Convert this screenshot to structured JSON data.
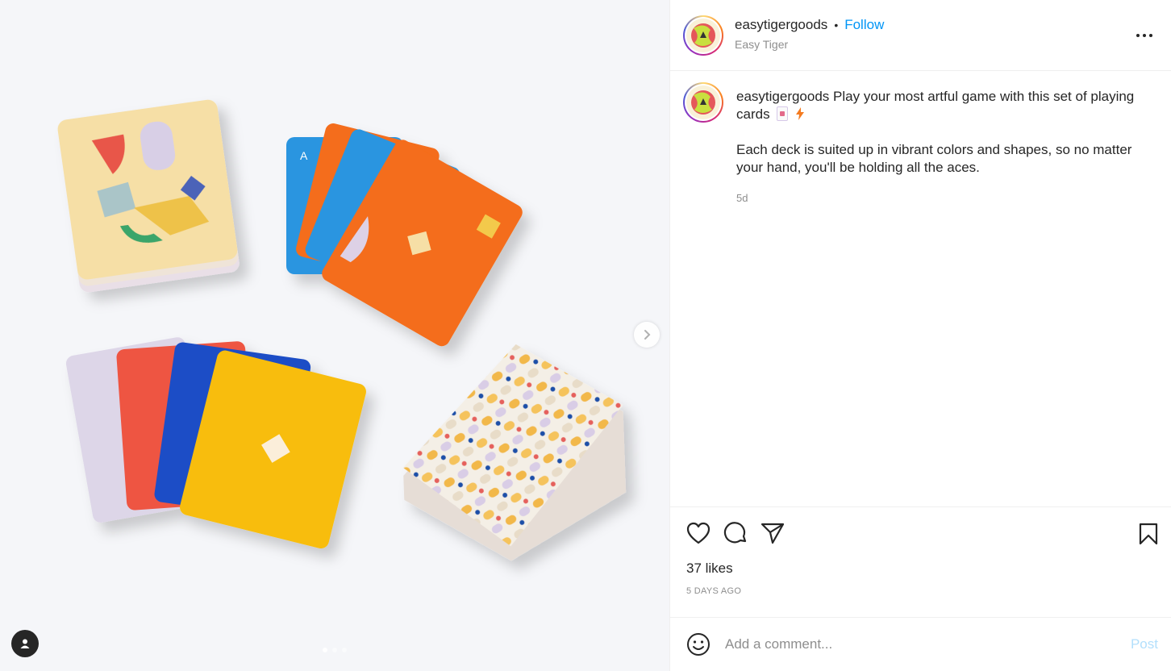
{
  "post": {
    "username": "easytigergoods",
    "separator": "•",
    "follow_label": "Follow",
    "subtitle": "Easy Tiger",
    "caption_line1": "Play your most artful game with this set of playing cards",
    "caption_para": "Each deck is suited up in vibrant colors and shapes, so no matter your hand, you'll be holding all the aces.",
    "time_short": "5d",
    "likes": "37 likes",
    "time_long": "5 DAYS AGO"
  },
  "comment": {
    "placeholder": "Add a comment...",
    "post_label": "Post"
  },
  "carousel": {
    "slide_count": 3,
    "current_slide": 1
  },
  "icons": {
    "more": "more-options-icon",
    "like": "heart-icon",
    "comment": "comment-bubble-icon",
    "share": "paper-plane-icon",
    "save": "bookmark-icon",
    "emoji": "smiley-icon",
    "next": "chevron-right-icon",
    "tag": "user-tag-icon"
  },
  "colors": {
    "accent": "#0095f6",
    "post_disabled": "#b2dffc",
    "muted": "#8e8e8e"
  }
}
